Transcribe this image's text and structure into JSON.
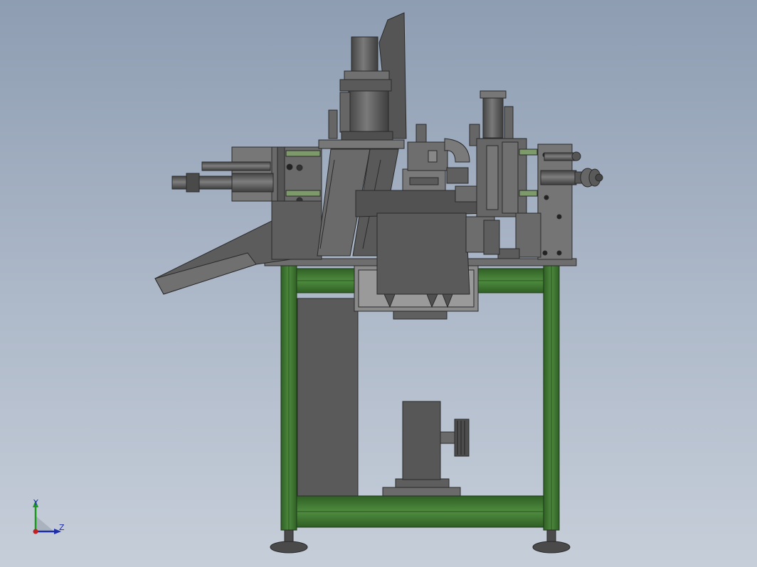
{
  "view": {
    "triad": {
      "y_label": "Y",
      "z_label": "Z"
    }
  },
  "colors": {
    "background_top": "#8e9db2",
    "background_bottom": "#c6ced9",
    "frame_green": "#3f7a32",
    "steel_dark": "#535353",
    "steel_mid": "#6a6a6a",
    "steel_light": "#8a8a8a",
    "axis_y": "#1a9a1a",
    "axis_z": "#1e2ea8",
    "axis_x": "#c02020"
  }
}
